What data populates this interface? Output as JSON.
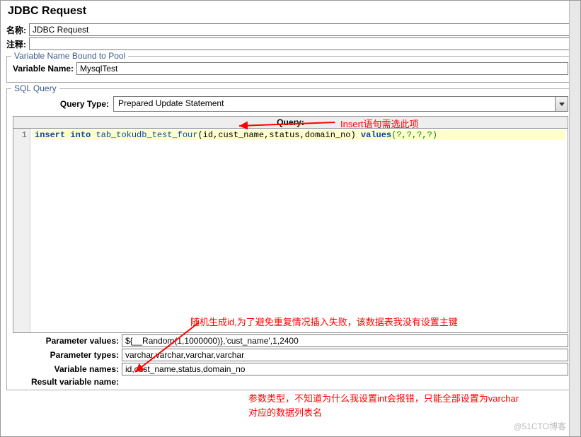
{
  "title": "JDBC Request",
  "name_label": "名称:",
  "name_value": "JDBC Request",
  "comment_label": "注释:",
  "comment_value": "",
  "pool": {
    "legend": "Variable Name Bound to Pool",
    "var_label": "Variable Name:",
    "var_value": "MysqlTest"
  },
  "sql": {
    "legend": "SQL Query",
    "qtype_label": "Query Type:",
    "qtype_value": "Prepared Update Statement",
    "query_header": "Query:",
    "line_no": "1",
    "code": {
      "kw1": "insert",
      "kw2": "into",
      "tbl": "tab_tokudb_test_four",
      "cols": "(id,cust_name,status,domain_no)",
      "kw3": "values",
      "vals": "(?,?,?,?)"
    },
    "param_values_label": "Parameter values:",
    "param_values": "${__Random(1,1000000)},'cust_name',1,2400",
    "param_types_label": "Parameter types:",
    "param_types": "varchar,varchar,varchar,varchar",
    "var_names_label": "Variable names:",
    "var_names": "id,cust_name,status,domain_no",
    "result_var_label": "Result variable name:"
  },
  "annotations": {
    "a1": "Insert语句需选此项",
    "a2": "随机生成id,为了避免重复情况插入失败，该数据表我没有设置主键",
    "a3": "参数类型，不知道为什么我设置int会报错，只能全部设置为varchar",
    "a4": "对应的数据列表名"
  },
  "watermark": "@51CTO博客"
}
